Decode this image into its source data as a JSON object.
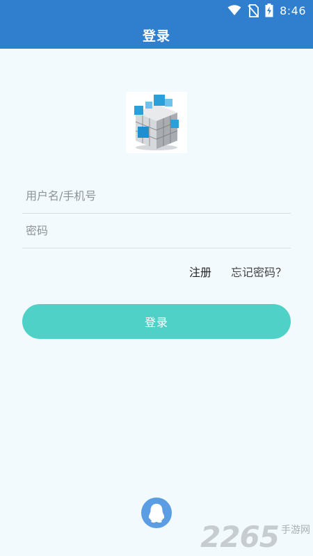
{
  "status_bar": {
    "time": "8:46",
    "icons": [
      "wifi-icon",
      "no-sim-icon",
      "battery-charging-icon"
    ]
  },
  "app_bar": {
    "title": "登录"
  },
  "logo": {
    "icon": "cube-logo-icon"
  },
  "form": {
    "username_placeholder": "用户名/手机号",
    "password_placeholder": "密码",
    "username_value": "",
    "password_value": ""
  },
  "links": {
    "register": "注册",
    "forgot": "忘记密码？"
  },
  "login_button": {
    "label": "登录"
  },
  "social": {
    "qq_icon": "qq-penguin-icon"
  },
  "watermark": {
    "number": "2265",
    "text": "手游网"
  },
  "colors": {
    "primary": "#2f7fce",
    "accent": "#4fd1c7",
    "background": "#f3fafd",
    "qq": "#5a9de3"
  }
}
